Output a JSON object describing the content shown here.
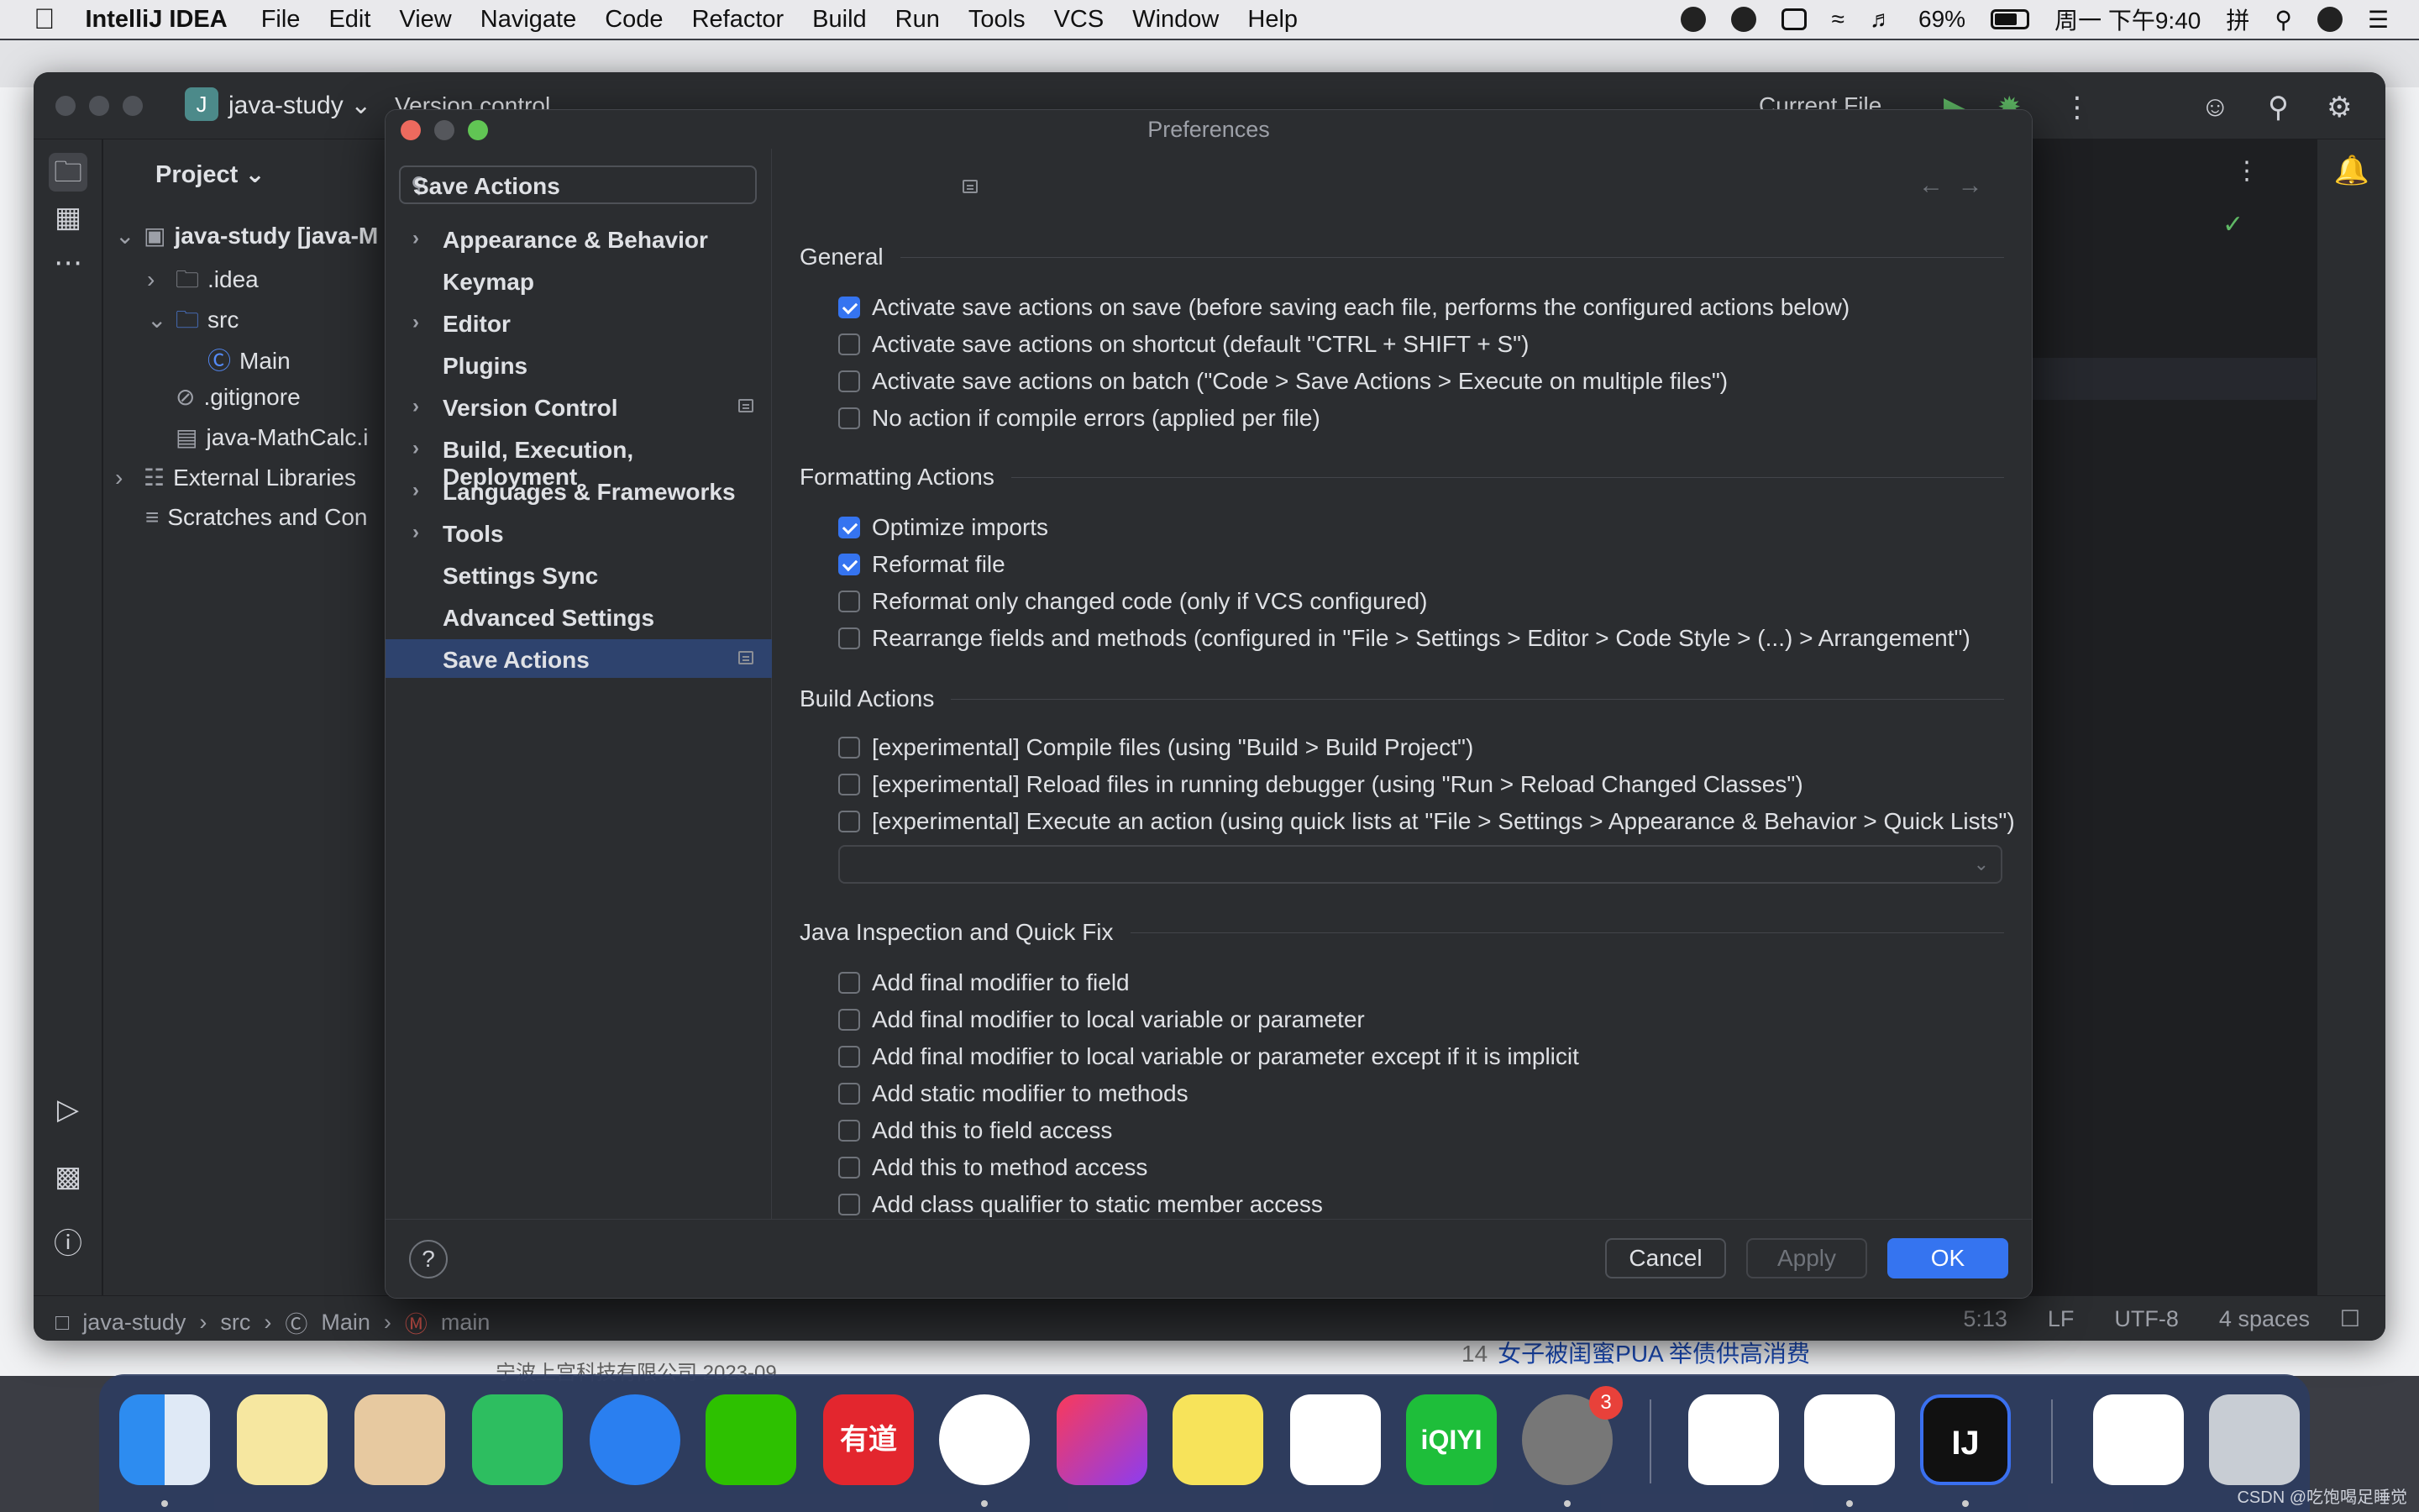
{
  "menubar": {
    "app": "IntelliJ IDEA",
    "items": [
      "File",
      "Edit",
      "View",
      "Navigate",
      "Code",
      "Refactor",
      "Build",
      "Run",
      "Tools",
      "VCS",
      "Window",
      "Help"
    ],
    "battery": "69%",
    "clock": "周一 下午9:40",
    "input_method": "拼"
  },
  "background": {
    "news_num": "14",
    "news_text": "女子被闺蜜PUA 举债供高消费",
    "ad_text": "宁波上宫科技有限公司 2023-09"
  },
  "ide": {
    "project_badge": "J",
    "project_name": "java-study",
    "vcs_label": "Version control",
    "run_config": "Current File",
    "project_panel_title": "Project",
    "tree": {
      "root": "java-study [java-M",
      "idea": ".idea",
      "src": "src",
      "main": "Main",
      "gitignore": ".gitignore",
      "iml": "java-MathCalc.i",
      "external": "External Libraries",
      "scratches": "Scratches and Con"
    },
    "status": {
      "crumb_project": "java-study",
      "crumb_src": "src",
      "crumb_class": "Main",
      "crumb_method": "main",
      "position": "5:13",
      "line_sep": "LF",
      "encoding": "UTF-8",
      "indent": "4 spaces"
    }
  },
  "dialog": {
    "title": "Preferences",
    "search_placeholder": "",
    "nav": [
      {
        "label": "Appearance & Behavior"
      },
      {
        "label": "Keymap"
      },
      {
        "label": "Editor"
      },
      {
        "label": "Plugins"
      },
      {
        "label": "Version Control"
      },
      {
        "label": "Build, Execution, Deployment"
      },
      {
        "label": "Languages & Frameworks"
      },
      {
        "label": "Tools"
      },
      {
        "label": "Settings Sync"
      },
      {
        "label": "Advanced Settings"
      },
      {
        "label": "Save Actions"
      }
    ],
    "content_title": "Save Actions",
    "sections": {
      "general": "General",
      "formatting": "Formatting Actions",
      "build": "Build Actions",
      "java": "Java Inspection and Quick Fix"
    },
    "general_opts": [
      {
        "label": "Activate save actions on save (before saving each file, performs the configured actions below)",
        "checked": true
      },
      {
        "label": "Activate save actions on shortcut (default \"CTRL + SHIFT + S\")",
        "checked": false
      },
      {
        "label": "Activate save actions on batch (\"Code > Save Actions > Execute on multiple files\")",
        "checked": false
      },
      {
        "label": "No action if compile errors (applied per file)",
        "checked": false
      }
    ],
    "formatting_opts": [
      {
        "label": "Optimize imports",
        "checked": true
      },
      {
        "label": "Reformat file",
        "checked": true
      },
      {
        "label": "Reformat only changed code (only if VCS configured)",
        "checked": false
      },
      {
        "label": "Rearrange fields and methods (configured in \"File > Settings > Editor > Code Style > (...) > Arrangement\")",
        "checked": false
      }
    ],
    "build_opts": [
      {
        "label": "[experimental] Compile files (using \"Build > Build Project\")",
        "checked": false
      },
      {
        "label": "[experimental] Reload files in running debugger (using \"Run > Reload Changed Classes\")",
        "checked": false
      },
      {
        "label": "[experimental] Execute an action (using quick lists at \"File > Settings > Appearance & Behavior > Quick Lists\")",
        "checked": false
      }
    ],
    "java_opts": [
      {
        "label": "Add final modifier to field",
        "checked": false
      },
      {
        "label": "Add final modifier to local variable or parameter",
        "checked": false
      },
      {
        "label": "Add final modifier to local variable or parameter except if it is implicit",
        "checked": false
      },
      {
        "label": "Add static modifier to methods",
        "checked": false
      },
      {
        "label": "Add this to field access",
        "checked": false
      },
      {
        "label": "Add this to method access",
        "checked": false
      },
      {
        "label": "Add class qualifier to static member access",
        "checked": false
      }
    ],
    "buttons": {
      "help": "?",
      "cancel": "Cancel",
      "apply": "Apply",
      "ok": "OK"
    }
  },
  "dock": {
    "youdao": "有道",
    "iqiyi": "iQIYI",
    "intellij": "IJ",
    "settings_badge": "3"
  },
  "watermark": "CSDN @吃饱喝足睡觉",
  "colors": {
    "accent": "#3574f0",
    "selection": "#2e436e",
    "panel": "#2b2d30"
  }
}
